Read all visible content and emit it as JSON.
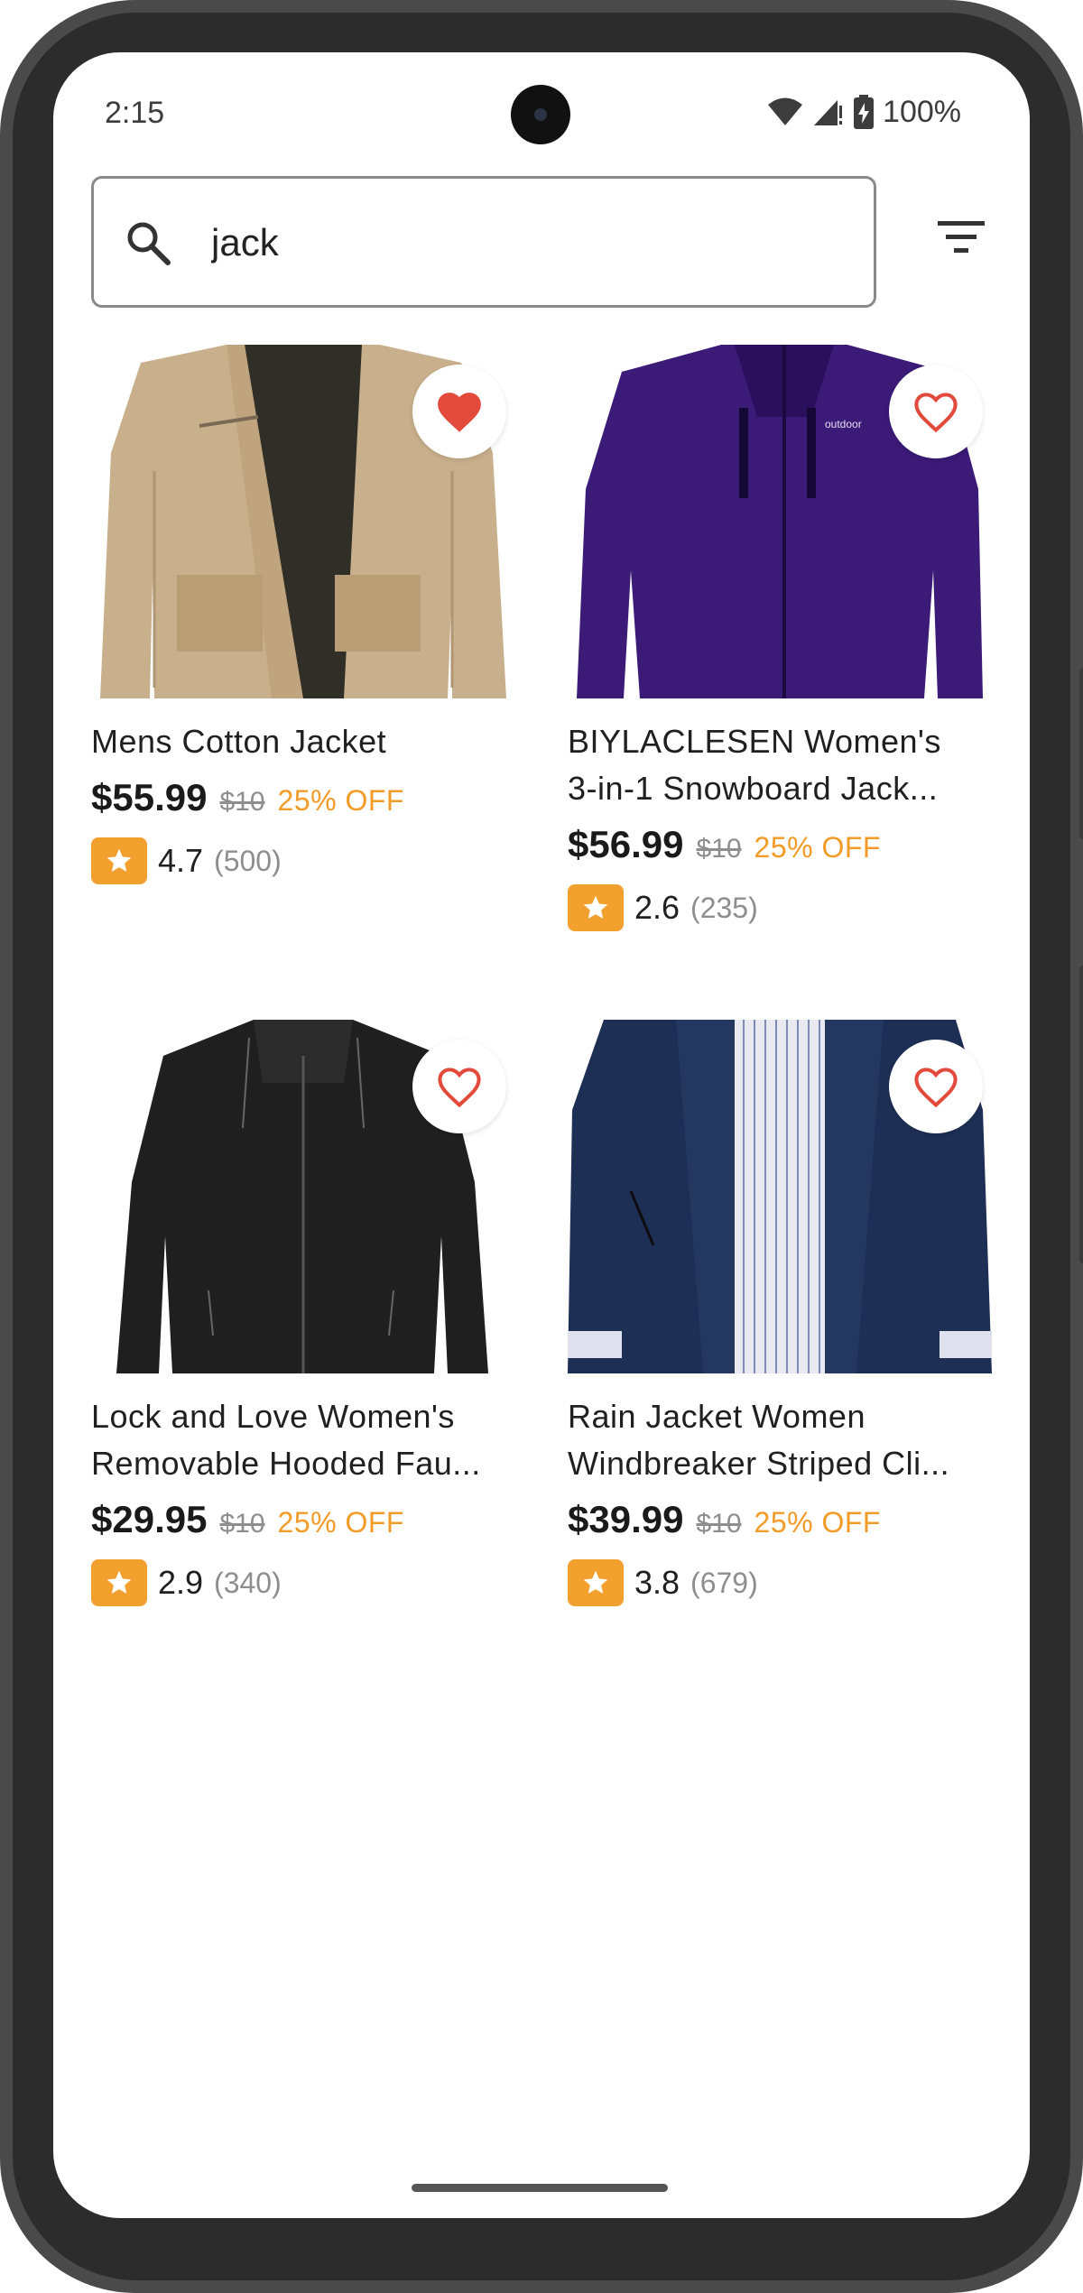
{
  "status_bar": {
    "time": "2:15",
    "battery": "100%",
    "icons": [
      "wifi-icon",
      "signal-icon",
      "battery-charging-icon"
    ]
  },
  "search": {
    "value": "jack",
    "icon": "search-icon"
  },
  "filter": {
    "icon": "filter-icon"
  },
  "colors": {
    "accent": "#f29b26",
    "heart": "#e24b3b",
    "star_bg": "#f2a02e"
  },
  "products": [
    {
      "title_line1": "Mens Cotton Jacket",
      "title_line2": "",
      "price": "$55.99",
      "old_price": "$10",
      "discount": "25% OFF",
      "rating": "4.7",
      "reviews": "(500)",
      "favorited": true
    },
    {
      "title_line1": "BIYLACLESEN Women's",
      "title_line2": "3-in-1 Snowboard Jack...",
      "price": "$56.99",
      "old_price": "$10",
      "discount": "25% OFF",
      "rating": "2.6",
      "reviews": "(235)",
      "favorited": false
    },
    {
      "title_line1": "Lock and Love Women's",
      "title_line2": "Removable Hooded Fau...",
      "price": "$29.95",
      "old_price": "$10",
      "discount": "25% OFF",
      "rating": "2.9",
      "reviews": "(340)",
      "favorited": false
    },
    {
      "title_line1": "Rain Jacket Women",
      "title_line2": "Windbreaker Striped Cli...",
      "price": "$39.99",
      "old_price": "$10",
      "discount": "25% OFF",
      "rating": "3.8",
      "reviews": "(679)",
      "favorited": false
    }
  ]
}
